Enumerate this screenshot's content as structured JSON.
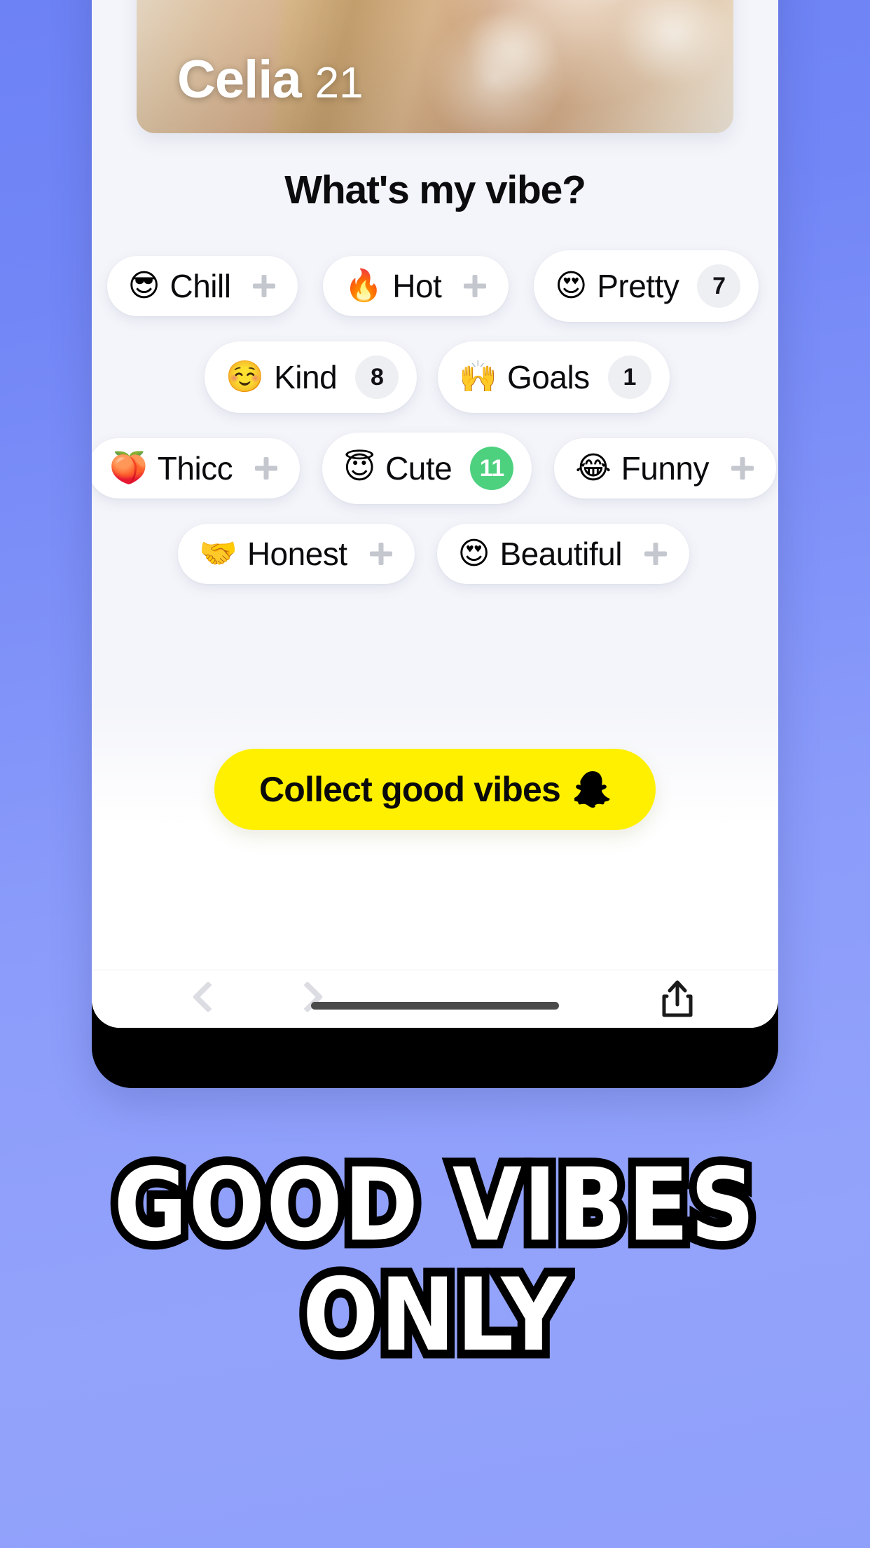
{
  "theme": {
    "background_gradient_from": "#6d82f5",
    "background_gradient_to": "#93a3fb",
    "cta_yellow": "#fff000",
    "badge_green": "#4ed17f",
    "badge_grey": "#eeeff3",
    "chip_white": "#ffffff",
    "page_bg": "#f4f5fa"
  },
  "profile": {
    "name": "Celia",
    "age": "21"
  },
  "main": {
    "title": "What's my vibe?",
    "chip_rows": [
      [
        {
          "emoji": "😎",
          "emoji_name": "smiling-face-with-sunglasses",
          "label": "Chill",
          "action": "plus",
          "count": null,
          "badge_style": null
        },
        {
          "emoji": "🔥",
          "emoji_name": "fire",
          "label": "Hot",
          "action": "plus",
          "count": null,
          "badge_style": null
        },
        {
          "emoji": "😍",
          "emoji_name": "smiling-face-with-heart-eyes",
          "label": "Pretty",
          "action": "count",
          "count": "7",
          "badge_style": "grey"
        }
      ],
      [
        {
          "emoji": "☺️",
          "emoji_name": "smiling-face",
          "label": "Kind",
          "action": "count",
          "count": "8",
          "badge_style": "grey"
        },
        {
          "emoji": "🙌",
          "emoji_name": "raising-hands",
          "label": "Goals",
          "action": "count",
          "count": "1",
          "badge_style": "grey"
        }
      ],
      [
        {
          "emoji": "🍑",
          "emoji_name": "peach",
          "label": "Thicc",
          "action": "plus",
          "count": null,
          "badge_style": null
        },
        {
          "emoji": "😇",
          "emoji_name": "smiling-face-with-halo",
          "label": "Cute",
          "action": "count",
          "count": "11",
          "badge_style": "green"
        },
        {
          "emoji": "😂",
          "emoji_name": "face-with-tears-of-joy",
          "label": "Funny",
          "action": "plus",
          "count": null,
          "badge_style": null
        }
      ],
      [
        {
          "emoji": "🤝",
          "emoji_name": "handshake",
          "label": "Honest",
          "action": "plus",
          "count": null,
          "badge_style": null
        },
        {
          "emoji": "😍",
          "emoji_name": "smiling-face-with-heart-eyes",
          "label": "Beautiful",
          "action": "plus",
          "count": null,
          "badge_style": null
        }
      ]
    ],
    "cta": {
      "label": "Collect good vibes",
      "icon": "snapchat-ghost-icon"
    }
  },
  "browser_chrome": {
    "back_icon": "chevron-left-icon",
    "forward_icon": "chevron-right-icon",
    "share_icon": "share-up-icon"
  },
  "promo": {
    "line1": "GOOD VIBES",
    "line2": "ONLY"
  }
}
